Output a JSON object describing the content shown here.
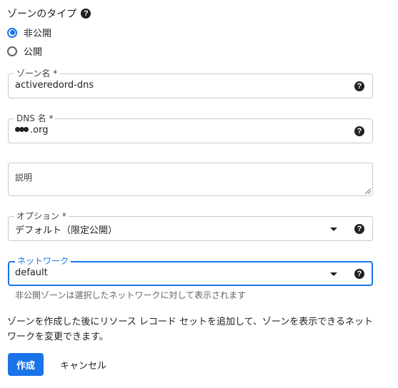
{
  "zone_type": {
    "title": "ゾーンのタイプ",
    "help_icon": "help-circle-icon",
    "options": [
      {
        "label": "非公開",
        "selected": true
      },
      {
        "label": "公開",
        "selected": false
      }
    ]
  },
  "zone_name": {
    "label": "ゾーン名 *",
    "value": "activeredord-dns"
  },
  "dns_name": {
    "label": "DNS 名 *",
    "value": ".org"
  },
  "description": {
    "placeholder": "説明"
  },
  "options": {
    "label": "オプション *",
    "value": "デフォルト（限定公開）"
  },
  "network": {
    "label": "ネットワーク",
    "value": "default",
    "hint": "非公開ゾーンは選択したネットワークに対して表示されます"
  },
  "info_text": "ゾーンを作成した後にリソース レコード セットを追加して、ゾーンを表示できるネットワークを変更できます。",
  "buttons": {
    "create": "作成",
    "cancel": "キャンセル"
  },
  "colors": {
    "accent": "#1a73e8",
    "text": "#202124",
    "border": "#c8cacd"
  }
}
